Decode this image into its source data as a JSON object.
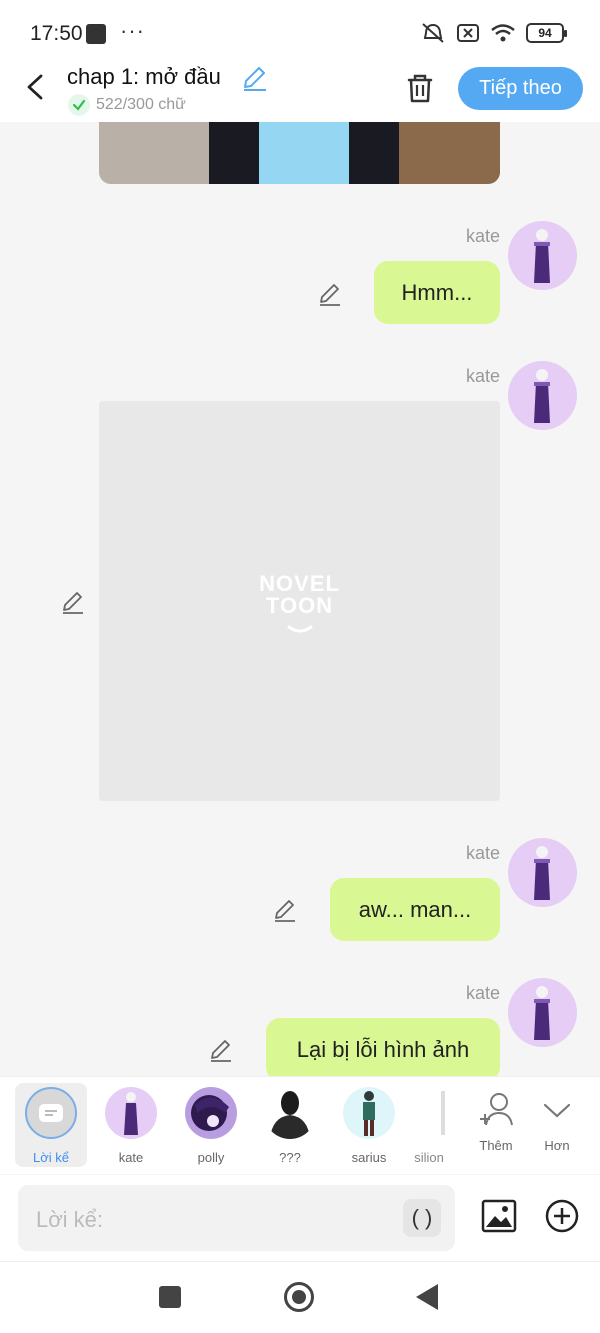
{
  "status": {
    "time": "17:50",
    "dots": "···",
    "battery": "94"
  },
  "header": {
    "title": "chap 1: mở đầu",
    "word_count": "522/300 chữ",
    "next_label": "Tiếp theo"
  },
  "messages": [
    {
      "name": "kate",
      "text": "Hmm..."
    },
    {
      "name": "kate",
      "image_watermark_line1": "NOVEL",
      "image_watermark_line2": "TOON"
    },
    {
      "name": "kate",
      "text": "aw... man..."
    },
    {
      "name": "kate",
      "text": "Lại bị lỗi hình ảnh"
    }
  ],
  "characters": [
    {
      "label": "Lời kể",
      "selected": true
    },
    {
      "label": "kate"
    },
    {
      "label": "polly"
    },
    {
      "label": "???"
    },
    {
      "label": "sarius"
    },
    {
      "label": "silion"
    },
    {
      "label": "Thêm"
    },
    {
      "label": "Hơn"
    }
  ],
  "input": {
    "placeholder": "Lời kể:",
    "paren_label": "( )"
  },
  "colors": {
    "accent": "#55a9f3",
    "bubble": "#d9f792",
    "avatar_bg": "#e5cdf6"
  }
}
